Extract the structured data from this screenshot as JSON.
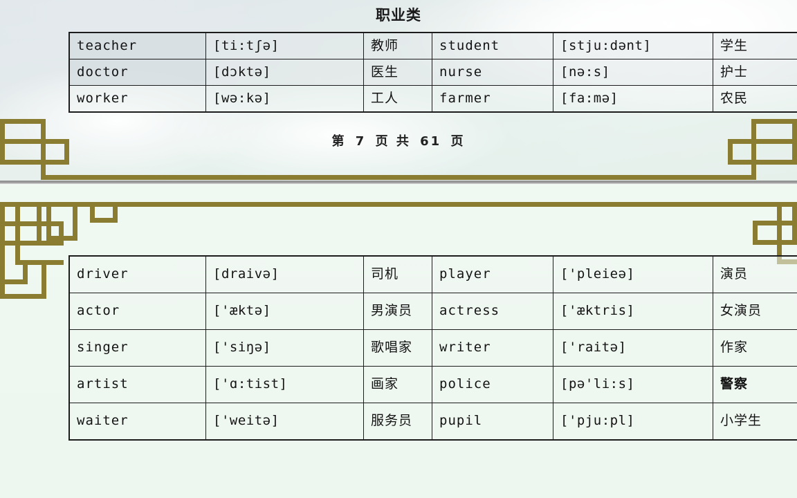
{
  "slide_top": {
    "title": "职业类",
    "footer": {
      "prefix": "第",
      "page": "7",
      "middle": "页  共",
      "total": "61",
      "suffix": "页"
    },
    "table": {
      "rows": [
        {
          "en1": "teacher",
          "ipa1": "[ti:tʃə]",
          "cn1": "教师",
          "en2": "student",
          "ipa2": "[stju:dənt]",
          "cn2": "学生"
        },
        {
          "en1": "doctor",
          "ipa1": "[dɔktə]",
          "cn1": "医生",
          "en2": "nurse",
          "ipa2": "[nə:s]",
          "cn2": "护士"
        },
        {
          "en1": "worker",
          "ipa1": "[wə:kə]",
          "cn1": "工人",
          "en2": "farmer",
          "ipa2": "[fa:mə]",
          "cn2": "农民"
        }
      ]
    }
  },
  "slide_bottom": {
    "table": {
      "rows": [
        {
          "en1": "driver",
          "ipa1": "[draivə]",
          "cn1": "司机",
          "en2": "player",
          "ipa2": "['pleieə]",
          "cn2": "演员",
          "bold2": false
        },
        {
          "en1": "actor",
          "ipa1": "['æktə]",
          "cn1": "男演员",
          "en2": "actress",
          "ipa2": "['æktris]",
          "cn2": "女演员",
          "bold2": false
        },
        {
          "en1": "singer",
          "ipa1": "['siŋə]",
          "cn1": "歌唱家",
          "en2": "writer",
          "ipa2": "['raitə]",
          "cn2": "作家",
          "bold2": false
        },
        {
          "en1": "artist",
          "ipa1": "['ɑ:tist]",
          "cn1": "画家",
          "en2": "police",
          "ipa2": "[pə'li:s]",
          "cn2": "警察",
          "bold2": true
        },
        {
          "en1": "waiter",
          "ipa1": "['weitə]",
          "cn1": "服务员",
          "en2": "pupil",
          "ipa2": "['pju:pl]",
          "cn2": "小学生",
          "bold2": false
        }
      ]
    }
  },
  "colors": {
    "ornament_gold": "#8a7d32",
    "slide_top_bg": "#e6eeec",
    "slide_bottom_bg": "#eef7f0",
    "table_border": "#1c1c1c",
    "divider": "#8f8f8f"
  }
}
